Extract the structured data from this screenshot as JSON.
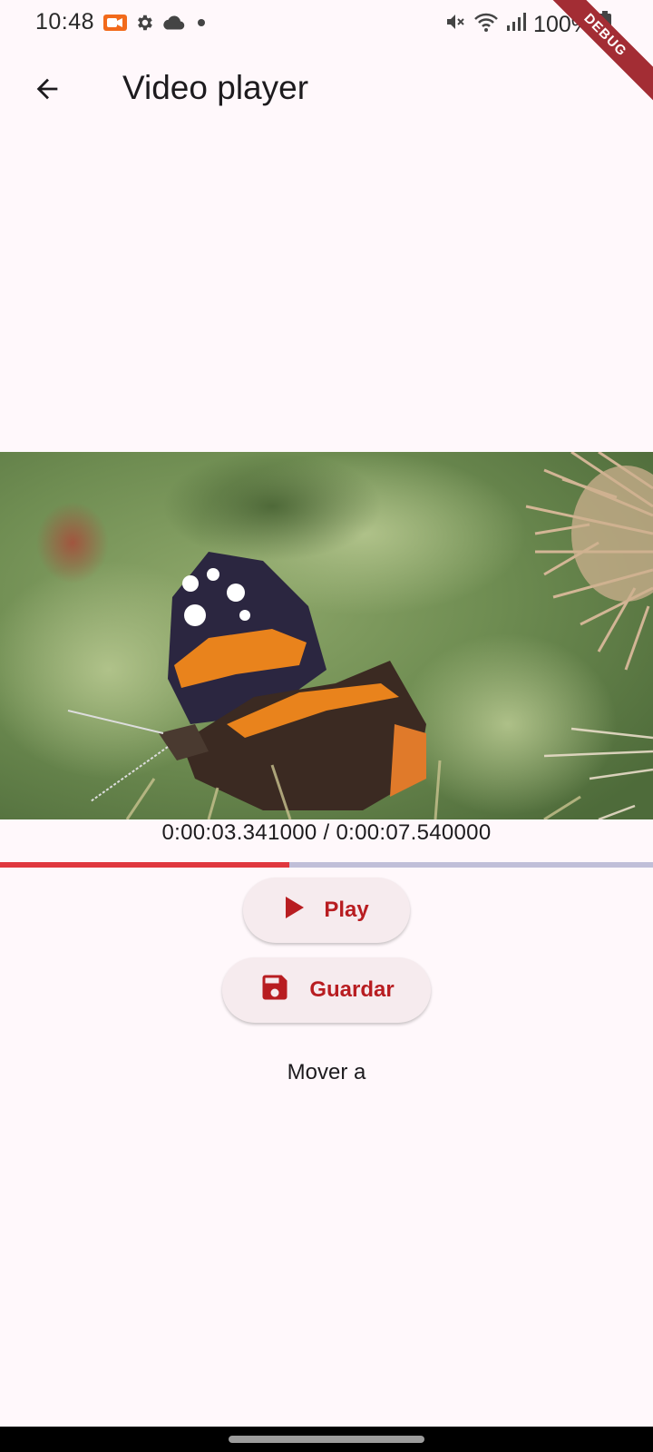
{
  "status_bar": {
    "time": "10:48",
    "battery": "100%",
    "left_icons": [
      "video-camera-icon",
      "gear-icon",
      "cloud-icon",
      "dot-icon"
    ],
    "right_icons": [
      "mute-icon",
      "wifi-icon",
      "signal-icon",
      "battery-icon"
    ],
    "debug_label": "DEBUG"
  },
  "app_bar": {
    "title": "Video player",
    "back_icon": "arrow-left-icon"
  },
  "player": {
    "time_readout": "0:00:03.341000 / 0:00:07.540000",
    "progress_fraction": 0.443,
    "progress_color": "#e0383f",
    "track_color": "#c0bfd8"
  },
  "buttons": {
    "play_label": "Play",
    "save_label": "Guardar"
  },
  "move_label": "Mover a",
  "colors": {
    "accent": "#b81d21",
    "background": "#fff8fb",
    "button_bg": "#f6ebee"
  }
}
